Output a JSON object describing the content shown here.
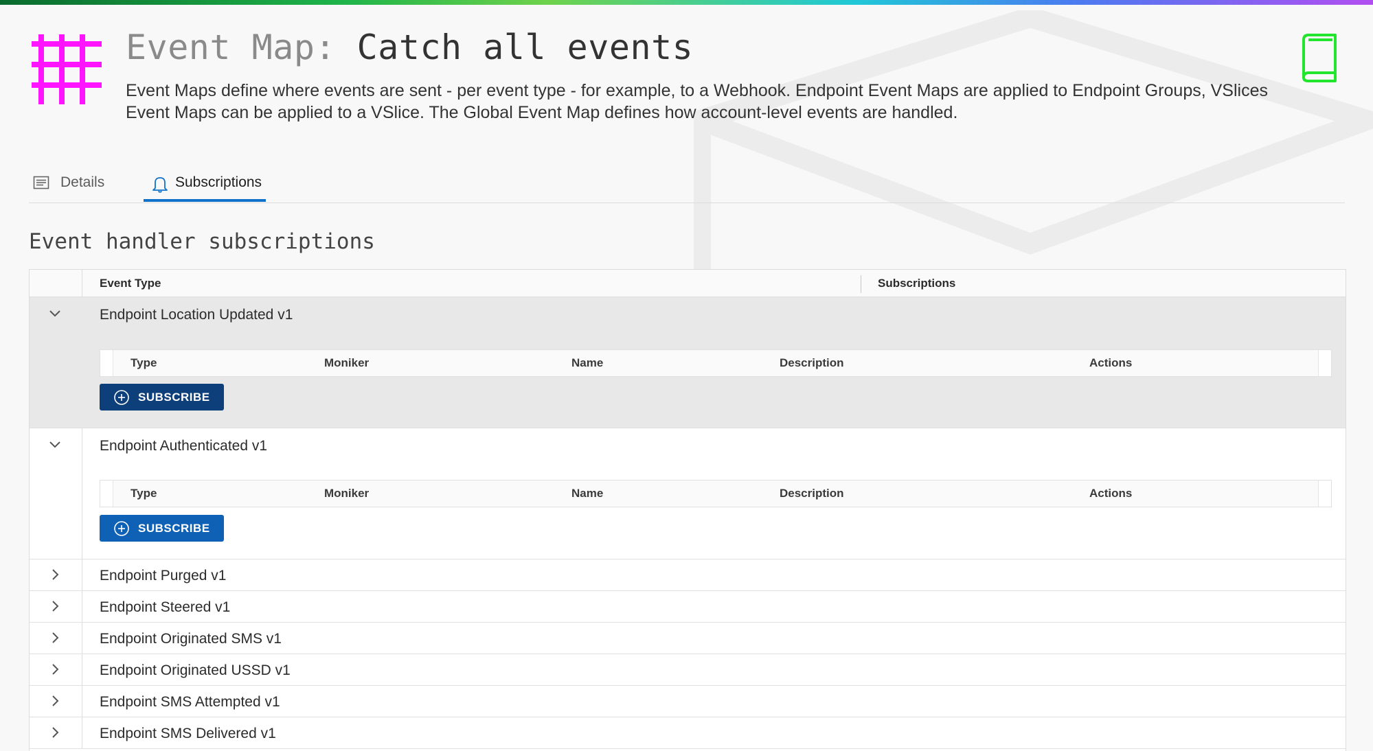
{
  "header": {
    "title_prefix": "Event Map:",
    "title_name": "Catch all events",
    "description": "Event Maps define where events are sent - per event type - for example, to a Webhook. Endpoint Event Maps are applied to Endpoint Groups, VSlices Event Maps can be applied to a VSlice. The Global Event Map defines how account-level events are handled.",
    "icon": "grid-icon",
    "doc_icon": "book-icon"
  },
  "colors": {
    "accent": "#0f72c8",
    "grid_icon": "#ff14ff",
    "book_icon": "#22e62e",
    "button_selected": "#0d3f7a",
    "button": "#0f61b5"
  },
  "tabs": [
    {
      "label": "Details",
      "icon": "list-icon",
      "active": false
    },
    {
      "label": "Subscriptions",
      "icon": "bell-icon",
      "active": true
    }
  ],
  "section_title": "Event handler subscriptions",
  "grid": {
    "columns": [
      "Event Type",
      "Subscriptions"
    ],
    "sub_columns": [
      "Type",
      "Moniker",
      "Name",
      "Description",
      "Actions"
    ],
    "subscribe_label": "SUBSCRIBE",
    "rows": [
      {
        "name": "Endpoint Location Updated v1",
        "expanded": true,
        "selected": true
      },
      {
        "name": "Endpoint Authenticated v1",
        "expanded": true,
        "selected": false
      },
      {
        "name": "Endpoint Purged v1",
        "expanded": false
      },
      {
        "name": "Endpoint Steered v1",
        "expanded": false
      },
      {
        "name": "Endpoint Originated SMS v1",
        "expanded": false
      },
      {
        "name": "Endpoint Originated USSD v1",
        "expanded": false
      },
      {
        "name": "Endpoint SMS Attempted v1",
        "expanded": false
      },
      {
        "name": "Endpoint SMS Delivered v1",
        "expanded": false
      }
    ]
  }
}
